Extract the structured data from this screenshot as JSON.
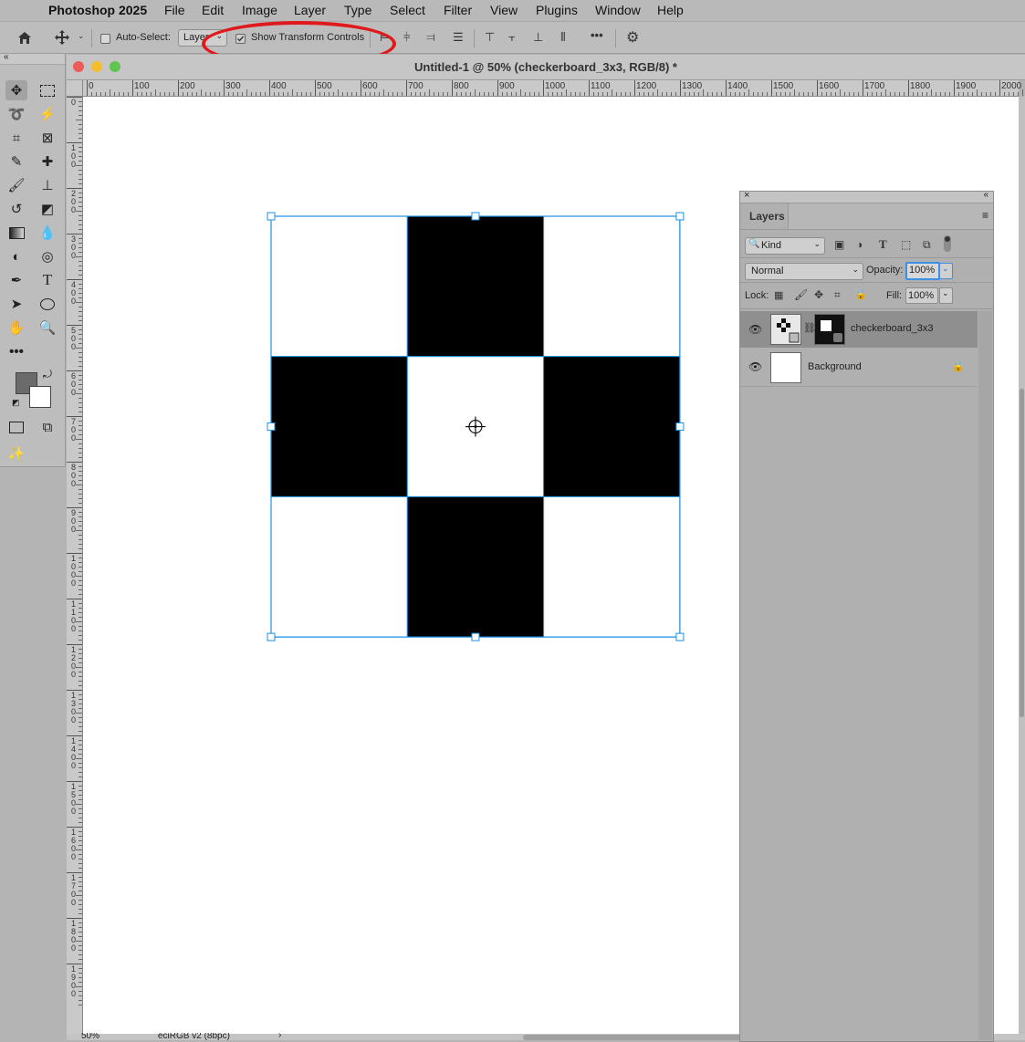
{
  "menubar": {
    "app_name": "Photoshop 2025",
    "items": [
      "File",
      "Edit",
      "Image",
      "Layer",
      "Type",
      "Select",
      "Filter",
      "View",
      "Plugins",
      "Window",
      "Help"
    ]
  },
  "optionsbar": {
    "auto_select_label": "Auto-Select:",
    "auto_select_target": "Layer",
    "show_transform_label": "Show Transform Controls",
    "show_transform_checked": true
  },
  "document": {
    "title": "Untitled-1 @ 50% (checkerboard_3x3, RGB/8) *",
    "ruler_h_ticks": [
      "0",
      "100",
      "200",
      "300",
      "400",
      "500",
      "600",
      "700",
      "800",
      "900",
      "1000",
      "1100",
      "1200",
      "1300",
      "1400",
      "1500",
      "1600",
      "1700",
      "1800",
      "1900",
      "2000"
    ],
    "ruler_v_ticks": [
      "0",
      "1 0 0",
      "2 0 0",
      "3 0 0",
      "4 0 0",
      "5 0 0",
      "6 0 0",
      "7 0 0",
      "8 0 0",
      "9 0 0",
      "1 0 0 0",
      "1 1 0 0",
      "1 2 0 0",
      "1 3 0 0",
      "1 4 0 0",
      "1 5 0 0",
      "1 6 0 0",
      "1 7 0 0",
      "1 8 0 0",
      "1 9 0 0"
    ],
    "checkerboard": [
      [
        0,
        1,
        0
      ],
      [
        1,
        0,
        1
      ],
      [
        0,
        1,
        0
      ]
    ],
    "zoom": "50%",
    "color_profile": "eciRGB v2 (8bpc)"
  },
  "layers_panel": {
    "tab_label": "Layers",
    "kind_filter": "Kind",
    "blend_mode": "Normal",
    "opacity_label": "Opacity:",
    "opacity_value": "100%",
    "lock_label": "Lock:",
    "fill_label": "Fill:",
    "fill_value": "100%",
    "layers": [
      {
        "name": "checkerboard_3x3",
        "selected": true
      },
      {
        "name": "Background",
        "locked": true
      }
    ]
  },
  "colors": {
    "selection_blue": "#1d8fe0",
    "annotation_red": "#e0191d",
    "foreground_swatch": "#6b6b6b",
    "background_swatch": "#ffffff"
  }
}
